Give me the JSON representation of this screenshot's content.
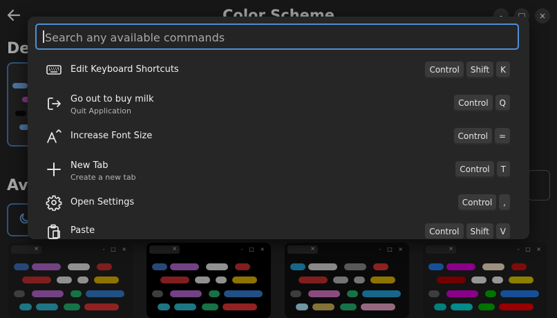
{
  "window": {
    "title": "Color Scheme",
    "minimize_label": "-",
    "maximize_label": "□",
    "close_label": "×"
  },
  "sections": {
    "default_title": "De",
    "available_title": "Ava"
  },
  "scheme_cards": [
    {
      "tab_close": "×",
      "ctrls": "- □ ×",
      "bg": "#1d1d1d"
    },
    {
      "tab_close": "×",
      "ctrls": "- □ ×",
      "bg": "#000000"
    },
    {
      "tab_close": "×",
      "ctrls": "- □ ×",
      "bg": "#0f0e0e"
    },
    {
      "tab_close": "×",
      "ctrls": "- □ ×",
      "bg": "#1c1c1c"
    }
  ],
  "palette": {
    "search_placeholder": "Search any available commands",
    "search_value": "",
    "commands": [
      {
        "icon": "keyboard-icon",
        "title": "Edit Keyboard Shortcuts",
        "subtitle": "",
        "keys": [
          "Control",
          "Shift",
          "K"
        ]
      },
      {
        "icon": "logout-icon",
        "title": "Go out to buy milk",
        "subtitle": "Quit Application",
        "keys": [
          "Control",
          "Q"
        ]
      },
      {
        "icon": "font-size-increase-icon",
        "title": "Increase Font Size",
        "subtitle": "",
        "keys": [
          "Control",
          "="
        ]
      },
      {
        "icon": "plus-icon",
        "title": "New Tab",
        "subtitle": "Create a new tab",
        "keys": [
          "Control",
          "T"
        ]
      },
      {
        "icon": "gear-icon",
        "title": "Open Settings",
        "subtitle": "",
        "keys": [
          "Control",
          ","
        ]
      },
      {
        "icon": "clipboard-icon",
        "title": "Paste",
        "subtitle": "",
        "keys": [
          "Control",
          "Shift",
          "V"
        ]
      }
    ]
  },
  "colors": {
    "accent": "#4f8fd6",
    "palette_bg": "#262626",
    "key_bg": "#3a3a3a"
  }
}
